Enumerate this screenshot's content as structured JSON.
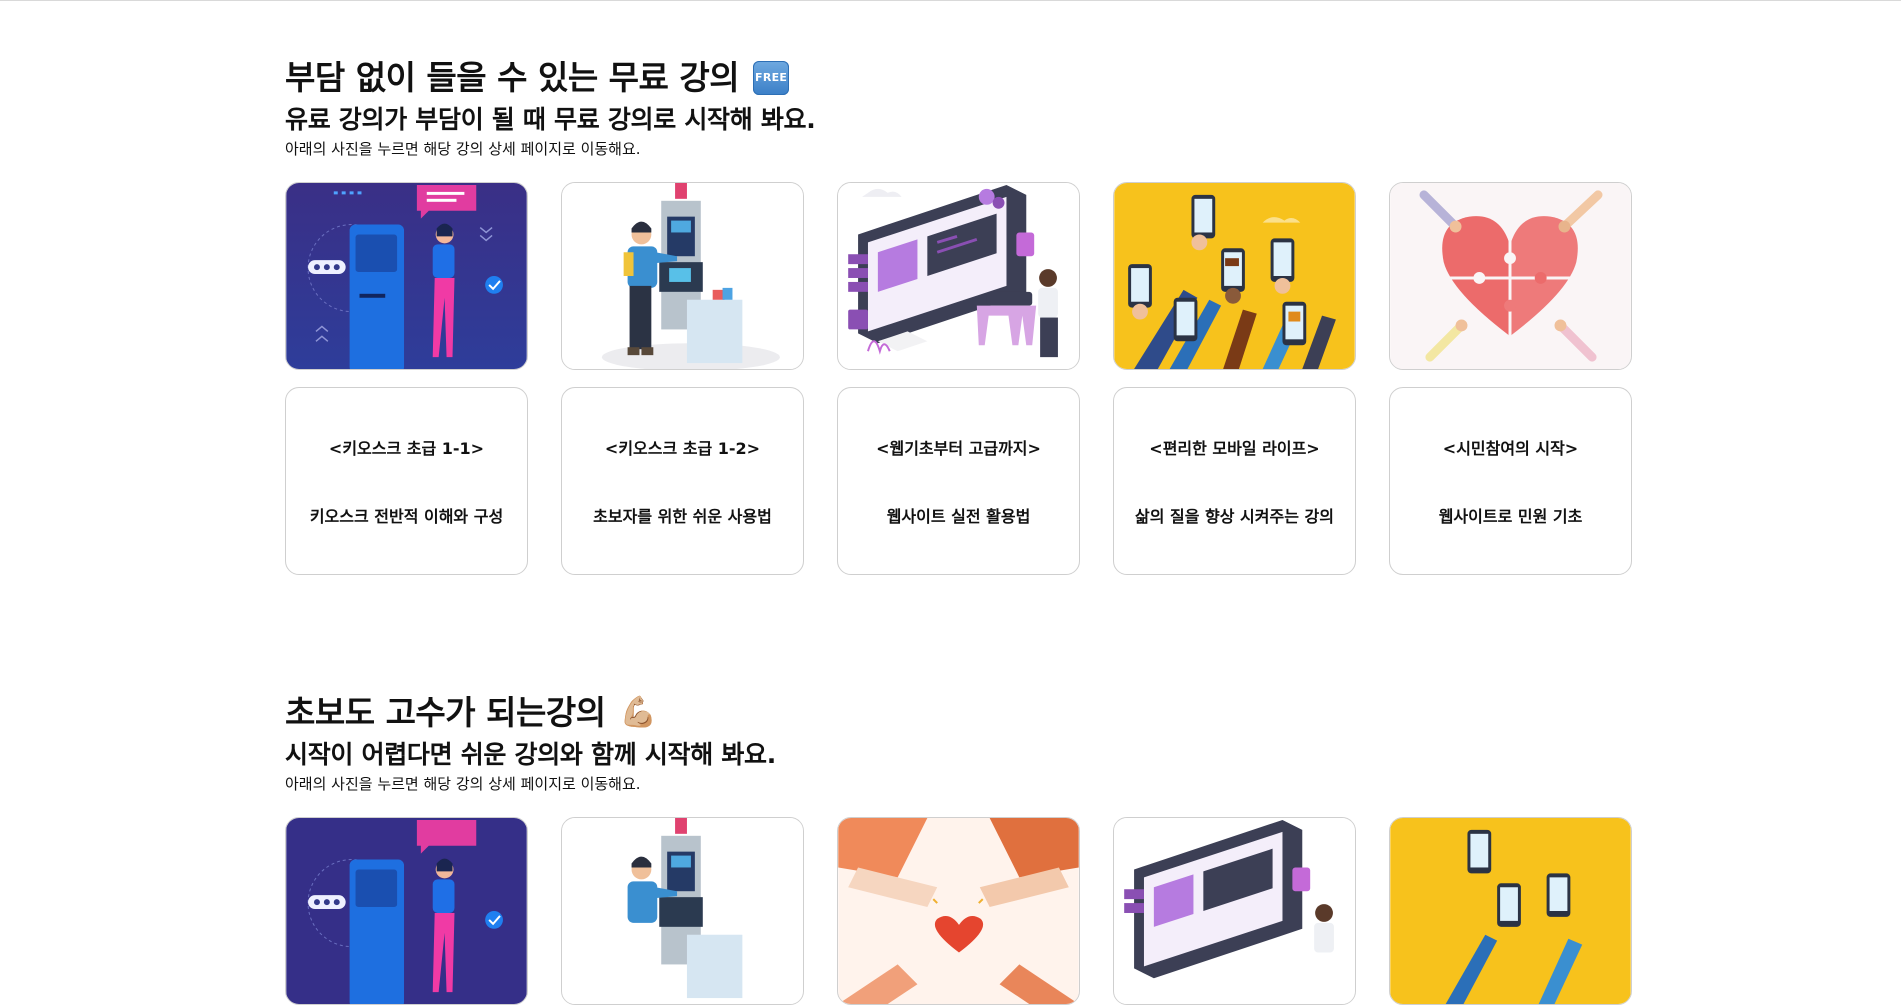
{
  "sections": [
    {
      "title": "부담 없이 들을 수 있는 무료 강의",
      "title_icon": "free-badge-icon",
      "title_icon_text": "FREE",
      "subtitle": "유료 강의가 부담이 될 때 무료 강의로 시작해 봐요.",
      "note": "아래의 사진을 누르면 해당 강의 상세 페이지로 이동해요.",
      "courses": [
        {
          "title": "<키오스크 초급 1-1>",
          "desc": "키오스크 전반적 이해와 구성",
          "image": "kiosk-woman-illustration"
        },
        {
          "title": "<키오스크 초급 1-2>",
          "desc": "초보자를 위한 쉬운 사용법",
          "image": "kiosk-man-illustration"
        },
        {
          "title": "<웹기초부터 고급까지>",
          "desc": "웹사이트 실전 활용법",
          "image": "web-developer-illustration"
        },
        {
          "title": "<편리한 모바일 라이프>",
          "desc": "삶의 질을 향상 시켜주는 강의",
          "image": "mobile-hands-illustration"
        },
        {
          "title": "<시민참여의 시작>",
          "desc": "웹사이트로 민원 기초",
          "image": "puzzle-heart-illustration"
        }
      ]
    },
    {
      "title": "초보도 고수가 되는강의",
      "title_icon": "flexed-biceps-icon",
      "title_icon_text": "💪🏼",
      "subtitle": "시작이 어렵다면 쉬운 강의와 함께 시작해 봐요.",
      "note": "아래의 사진을 누르면 해당 강의 상세 페이지로 이동해요.",
      "images": [
        "kiosk-woman-illustration",
        "kiosk-man-illustration",
        "hands-heart-illustration",
        "web-developer-illustration",
        "mobile-hands-illustration"
      ]
    }
  ],
  "colors": {
    "card_border": "#cfcfcf",
    "kiosk_bg": "#3a2f86",
    "mobile_bg": "#f7c21c",
    "puzzle_red": "#ec6b6b",
    "web_purple": "#8a4fb3"
  }
}
